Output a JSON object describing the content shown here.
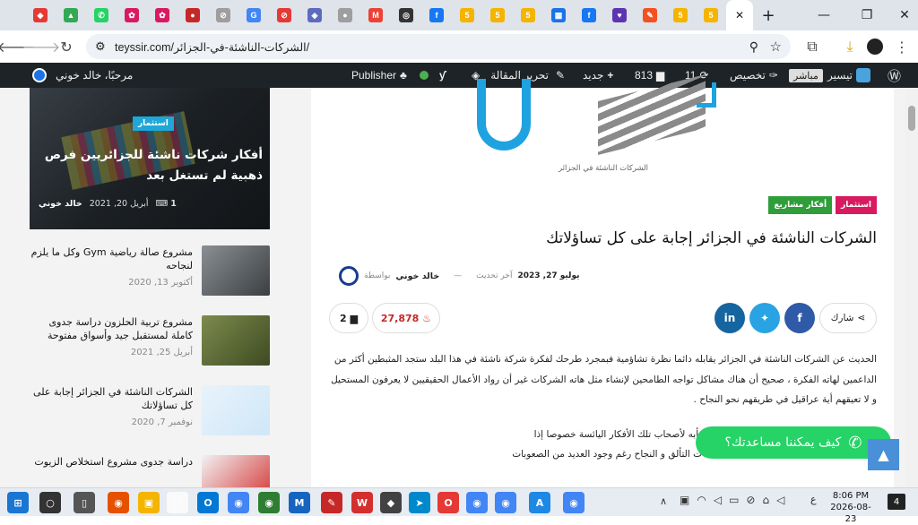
{
  "browser": {
    "tabs": [
      {
        "c": "#e53935",
        "g": "◆"
      },
      {
        "c": "#34a853",
        "g": "▲"
      },
      {
        "c": "#25d366",
        "g": "✆"
      },
      {
        "c": "#d81b60",
        "g": "✿"
      },
      {
        "c": "#d81b60",
        "g": "✿"
      },
      {
        "c": "#c62828",
        "g": "●"
      },
      {
        "c": "#9e9e9e",
        "g": "⊘"
      },
      {
        "c": "#4285f4",
        "g": "G"
      },
      {
        "c": "#e53935",
        "g": "⊘"
      },
      {
        "c": "#5c6bc0",
        "g": "◈"
      },
      {
        "c": "#9e9e9e",
        "g": "●"
      },
      {
        "c": "#ea4335",
        "g": "M"
      },
      {
        "c": "#333",
        "g": "◎"
      },
      {
        "c": "#1877f2",
        "g": "f"
      },
      {
        "c": "#f4b400",
        "g": "5"
      },
      {
        "c": "#f4b400",
        "g": "5"
      },
      {
        "c": "#f4b400",
        "g": "5"
      },
      {
        "c": "#1a73e8",
        "g": "▦"
      },
      {
        "c": "#1877f2",
        "g": "f"
      },
      {
        "c": "#5e35b1",
        "g": "♥"
      },
      {
        "c": "#f4511e",
        "g": "✎"
      },
      {
        "c": "#f4b400",
        "g": "5"
      },
      {
        "c": "#f4b400",
        "g": "5"
      }
    ],
    "url": "teyssir.com/الشركات-الناشئة-في-الجزائر/",
    "new_tab": "+",
    "minimize": "—",
    "restore": "❐",
    "close": "✕",
    "tab_close": "✕"
  },
  "wpbar": {
    "greeting": "مرحبًا، خالد خوني",
    "publisher": "Publisher",
    "edit_article": "تحرير المقالة",
    "new": "جديد",
    "comments": "813",
    "updates": "11",
    "customize": "تخصيص",
    "live": "مباشر",
    "site": "تيسير"
  },
  "sidebar": {
    "hero": {
      "badge": "استثمار",
      "title": "أفكار شركات ناشئة للجزائريين فرص ذهبية لم تستغل بعد",
      "author": "خالد خوني",
      "date": "أبريل 20, 2021",
      "comments": "1"
    },
    "posts": [
      {
        "title": "مشروع صالة رياضية Gym وكل ما يلزم لنجاحه",
        "date": "أكتوبر 13, 2020",
        "c1": "#8a8f93",
        "c2": "#3b3f42"
      },
      {
        "title": "مشروع تربية الحلزون دراسة جدوى كاملة لمستقبل جيد وأسواق مفتوحة",
        "date": "أبريل 25, 2021",
        "c1": "#7d8b4d",
        "c2": "#3e4a22"
      },
      {
        "title": "الشركات الناشئة في الجزائر إجابة على كل تساؤلاتك",
        "date": "نوفمبر 7, 2020",
        "c1": "#e8f3fb",
        "c2": "#cfe7f7"
      },
      {
        "title": "دراسة جدوى مشروع استخلاص الزيوت",
        "date": "",
        "c1": "#f2f2f2",
        "c2": "#d32f2f"
      }
    ]
  },
  "article": {
    "caption": "الشركات الناشئة في الجزائر",
    "badges": [
      "استثمار",
      "أفكار مشاريع"
    ],
    "title": "الشركات الناشئة في الجزائر إجابة على كل تساؤلاتك",
    "byline": "بواسطة",
    "author": "خالد خوني",
    "updated_label": "آخر تحديث",
    "updated": "يوليو 27, 2023",
    "share": "شارك",
    "views": "27,878",
    "comments": "2",
    "p1": "الحديث عن الشركات الناشئة في الجزائر يقابله دائما نظرة تشاؤمية  فبمجرد طرحك لفكرة شركة ناشئة في هذا البلد ستجد المثبطين أكثر من الداعمين لهاته الفكرة ، صحيح أن هناك مشاكل تواجه الطامحين لإنشاء مثل هاته الشركات غير أن رواد الأعمال الحقيقيين لا يعرفون المستحيل و لا تعيقهم أية عراقيل في طريقهم نحو النجاح  .",
    "p2a": "عن مشاريع الشركات الناشئة  في الجزائر ، لا تأبه لأصحاب تلك الأفكار اليائسة خصوصا إذا",
    "p2b": "ت التألق و النجاح رغم وجود العديد من الصعوبات"
  },
  "chat": {
    "label": "كيف يمكننا مساعدتك؟"
  },
  "taskbar": {
    "time": "8:06 PM",
    "date": "2026-08-23",
    "notif": "4",
    "lang": "ع",
    "items": [
      {
        "c": "#1976d2",
        "g": "⊞"
      },
      {
        "c": "#333",
        "g": "○"
      },
      {
        "c": "#555",
        "g": "▯"
      },
      {
        "c": "#e65100",
        "g": "◉"
      },
      {
        "c": "#f4b400",
        "g": "▣"
      },
      {
        "c": "#fafafa",
        "g": "▢"
      },
      {
        "c": "#0078d4",
        "g": "O"
      },
      {
        "c": "#4285f4",
        "g": "◉"
      },
      {
        "c": "#2e7d32",
        "g": "◉"
      },
      {
        "c": "#1565c0",
        "g": "M"
      },
      {
        "c": "#c62828",
        "g": "✎"
      },
      {
        "c": "#d32f2f",
        "g": "W"
      },
      {
        "c": "#424242",
        "g": "◆"
      },
      {
        "c": "#0088cc",
        "g": "➤"
      },
      {
        "c": "#e53935",
        "g": "O"
      },
      {
        "c": "#4285f4",
        "g": "◉"
      },
      {
        "c": "#4285f4",
        "g": "◉"
      },
      {
        "c": "#1e88e5",
        "g": "A"
      },
      {
        "c": "#4285f4",
        "g": "◉"
      }
    ]
  }
}
